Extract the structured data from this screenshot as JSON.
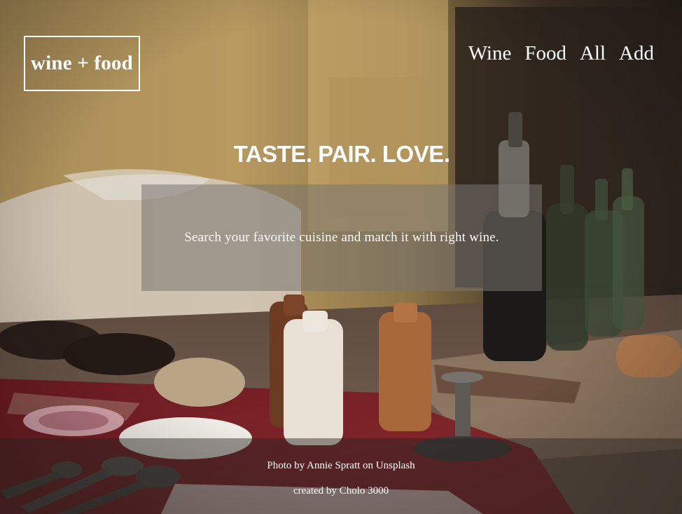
{
  "logo": {
    "text": "wine + food"
  },
  "nav": {
    "items": [
      "Wine",
      "Food",
      "All",
      "Add"
    ]
  },
  "hero": {
    "title": "TASTE. PAIR. LOVE.",
    "search_prompt": "Search your favorite cuisine and match it with right wine."
  },
  "footer": {
    "photo_credit": "Photo by Annie Spratt on Unsplash",
    "created_by": "created by Cholo 3000"
  },
  "colors": {
    "text": "#ffffff",
    "overlay": "#78746f",
    "table_cloth": "#7a1e24",
    "wall": "#c9a86a"
  }
}
